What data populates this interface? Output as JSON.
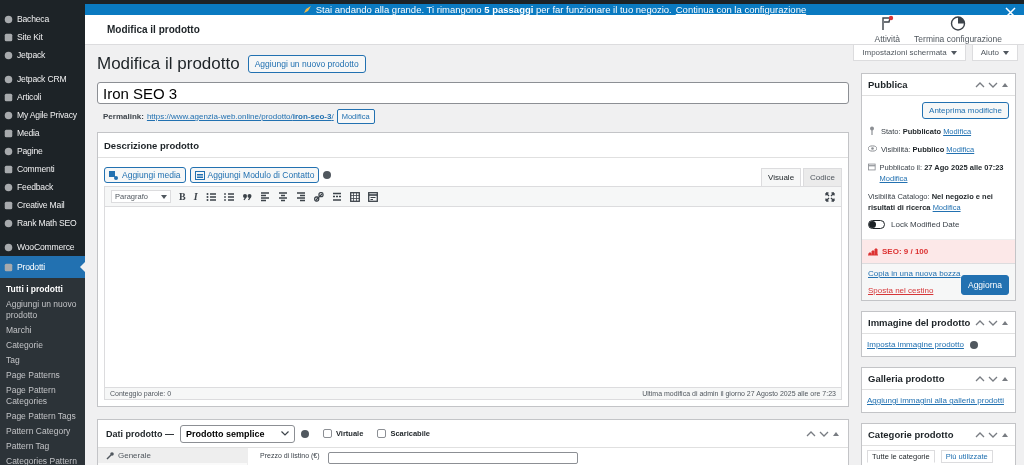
{
  "notice": {
    "text": "Stai andando alla grande. Ti rimangono **5 passaggi** per far funzionare il tuo negozio.",
    "link": "Continua con la configurazione"
  },
  "sidebar": {
    "groups": [
      [
        {
          "label": "Bacheca",
          "selected": false
        },
        {
          "label": "Site Kit",
          "selected": false
        },
        {
          "label": "Jetpack",
          "selected": false
        }
      ],
      [
        {
          "label": "Jetpack CRM",
          "selected": false
        },
        {
          "label": "Articoli",
          "selected": false
        },
        {
          "label": "My Agile Privacy",
          "selected": false
        },
        {
          "label": "Media",
          "selected": false
        },
        {
          "label": "Pagine",
          "selected": false
        },
        {
          "label": "Commenti",
          "selected": false
        },
        {
          "label": "Feedback",
          "selected": false
        },
        {
          "label": "Creative Mail",
          "selected": false
        },
        {
          "label": "Rank Math SEO",
          "selected": false
        }
      ],
      [
        {
          "label": "WooCommerce",
          "selected": false
        },
        {
          "label": "Prodotti",
          "selected": true,
          "children": [
            {
              "label": "Tutti i prodotti",
              "selected": true
            },
            {
              "label": "Aggiungi un nuovo prodotto",
              "selected": false
            },
            {
              "label": "Marchi",
              "selected": false
            },
            {
              "label": "Categorie",
              "selected": false
            },
            {
              "label": "Tag",
              "selected": false
            },
            {
              "label": "Page Patterns",
              "selected": false
            },
            {
              "label": "Page Pattern Categories",
              "selected": false
            },
            {
              "label": "Page Pattern Tags",
              "selected": false
            },
            {
              "label": "Pattern Category",
              "selected": false
            },
            {
              "label": "Pattern Tag",
              "selected": false
            },
            {
              "label": "Categories Pattern",
              "selected": false
            }
          ]
        }
      ]
    ]
  },
  "header": {
    "title": "Modifica il prodotto",
    "actions": [
      {
        "label": "Attività",
        "alert": true
      },
      {
        "label": "Termina configurazione",
        "alert": false
      }
    ]
  },
  "screen_buttons": [
    "Impostazioni schermata",
    "Aiuto"
  ],
  "page": {
    "title": "Modifica il prodotto",
    "add_new": "Aggiungi un nuovo prodotto"
  },
  "post_title": "Iron SEO 3",
  "permalink": {
    "label": "Permalink:",
    "url_base": "https://www.agenzia-web.online/prodotto/",
    "slug": "iron-seo-3",
    "trailing": "/",
    "button": "Modifica"
  },
  "description": {
    "title": "Descrizione prodotto",
    "media_buttons": [
      "Aggiungi media",
      "Aggiungi Modulo di Contatto"
    ],
    "tabs": [
      {
        "label": "Visuale",
        "selected": true
      },
      {
        "label": "Codice",
        "selected": false
      }
    ],
    "format": "Paragrafo",
    "text_buttons": [
      "B",
      "I"
    ],
    "word_count": "Conteggio parole: 0",
    "last_edit": "Ultima modifica di admin il giorno 27 Agosto 2025 alle ore 7:23"
  },
  "product_data": {
    "title": "Dati prodotto —",
    "type": "Prodotto semplice",
    "options": [
      {
        "label": "Virtuale",
        "checked": false
      },
      {
        "label": "Scaricabile",
        "checked": false
      }
    ],
    "tabs": [
      {
        "label": "Generale",
        "selected": true
      }
    ],
    "fields": [
      {
        "label": "Prezzo di listino (€)"
      }
    ]
  },
  "publish": {
    "title": "Pubblica",
    "preview": "Anteprima modifiche",
    "rows": [
      {
        "label": "Stato:",
        "value": "Pubblicato",
        "link": "Modifica"
      },
      {
        "label": "Visibilità:",
        "value": "Pubblico",
        "link": "Modifica"
      },
      {
        "label": "Pubblicato il:",
        "value": "27 Ago 2025 alle 07:23",
        "link": "Modifica"
      },
      {
        "label": "Visibilità Catalogo:",
        "value": "Nel negozio e nei risultati di ricerca",
        "link": "Modifica"
      }
    ],
    "lock": {
      "label": "Lock Modified Date",
      "on": false
    },
    "seo": "SEO: 9 / 100",
    "copy": "Copia in una nuova bozza",
    "trash": "Sposta nel cestino",
    "update": "Aggiorna"
  },
  "side_boxes": [
    {
      "title": "Immagine del prodotto",
      "link": "Imposta immagine prodotto"
    },
    {
      "title": "Galleria prodotto",
      "link": "Aggiungi immagini alla galleria prodotti"
    },
    {
      "title": "Categorie prodotto",
      "tabs": [
        {
          "label": "Tutte le categorie",
          "selected": true
        },
        {
          "label": "Più utilizzate",
          "selected": false
        }
      ]
    }
  ]
}
